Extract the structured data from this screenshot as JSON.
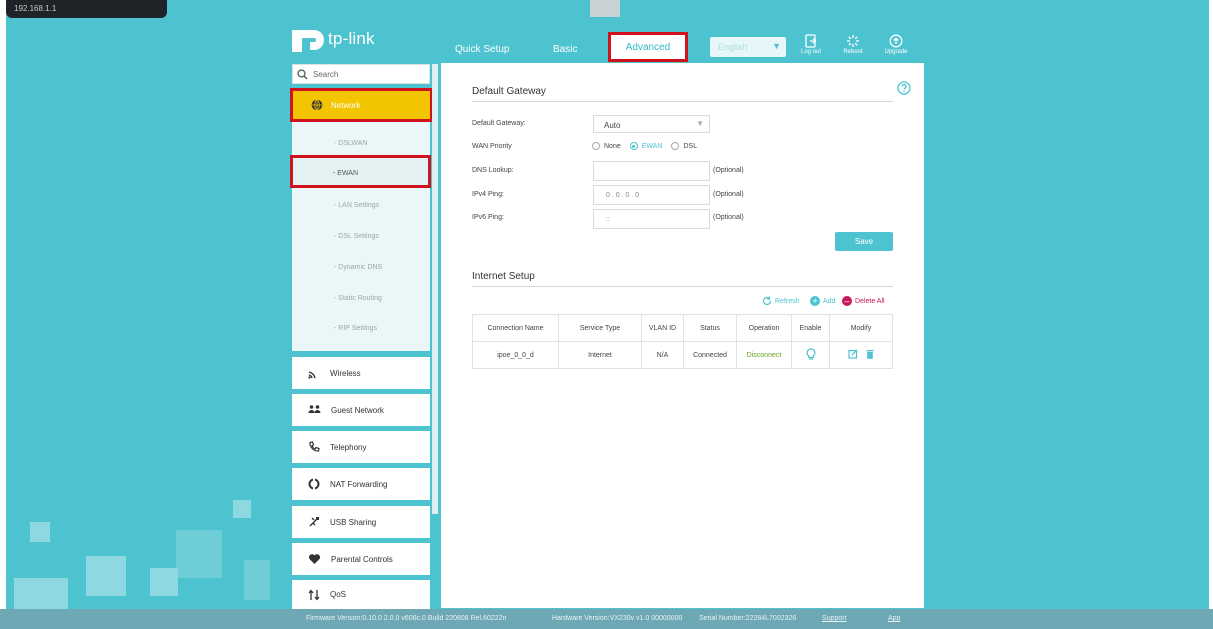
{
  "browser": {
    "url_tooltip": "192.168.1.1"
  },
  "brand": {
    "logo_text": "tp-link"
  },
  "nav": {
    "tabs": [
      "Quick Setup",
      "Basic",
      "Advanced"
    ],
    "language": "English",
    "logout": "Log out",
    "reboot": "Reboot",
    "upgrade": "Upgrade"
  },
  "sidebar": {
    "search_placeholder": "Search",
    "network": "Network",
    "network_sub": [
      "- DSLWAN",
      "- EWAN",
      "- LAN Settings",
      "- DSL Settings",
      "- Dynamic DNS",
      "- Static Routing",
      "- RIP Settings"
    ],
    "menu": [
      "Wireless",
      "Guest Network",
      "Telephony",
      "NAT Forwarding",
      "USB Sharing",
      "Parental Controls",
      "QoS"
    ]
  },
  "gateway": {
    "title": "Default Gateway",
    "default_gateway_label": "Default Gateway:",
    "default_gateway_value": "Auto",
    "wan_priority_label": "WAN Priority",
    "wan_options": [
      "None",
      "EWAN",
      "DSL"
    ],
    "dns_lookup_label": "DNS Lookup:",
    "ipv4_ping_label": "IPv4 Ping:",
    "ipv4_ping_value": "0  .  0  .  0  .  0",
    "ipv6_ping_label": "IPv6 Ping:",
    "ipv6_ping_value": "::",
    "optional": "(Optional)",
    "save": "Save"
  },
  "internet": {
    "title": "Internet Setup",
    "refresh": "Refresh",
    "add": "Add",
    "delete_all": "Delete All",
    "columns": [
      "Connection Name",
      "Service Type",
      "VLAN ID",
      "Status",
      "Operation",
      "Enable",
      "Modify"
    ],
    "rows": [
      {
        "name": "ipoe_0_0_d",
        "service": "Internet",
        "vlan": "N/A",
        "status": "Connected",
        "operation": "Disconnect"
      }
    ]
  },
  "footer": {
    "firmware": "Firmware Version:0.10.0 2.0.0 v606c.0 Build 220808 Rel.60222n",
    "hardware": "Hardware Version:VX230v v1.0 00000000",
    "serial": "Serial Number:22284L7002326",
    "support": "Support",
    "app": "App"
  },
  "colors": {
    "accent": "#4ec3d0",
    "highlight": "#f3c400",
    "annotation": "#d0121e",
    "link_green": "#6aa31c",
    "delete_red": "#c8195a"
  }
}
